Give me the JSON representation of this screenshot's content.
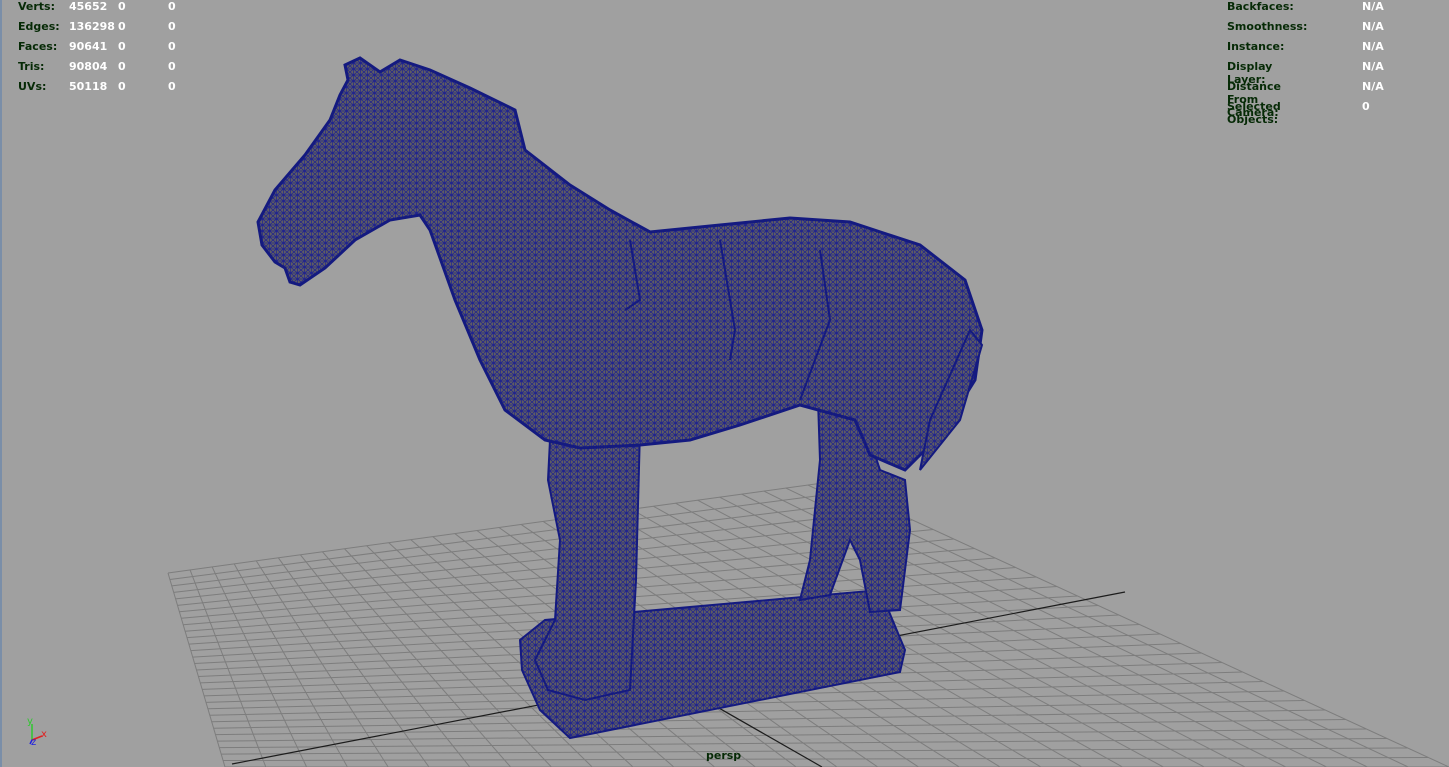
{
  "stats_left": {
    "rows": [
      {
        "label": "Verts:",
        "values": [
          "45652",
          "0",
          "0"
        ]
      },
      {
        "label": "Edges:",
        "values": [
          "136298",
          "0",
          "0"
        ]
      },
      {
        "label": "Faces:",
        "values": [
          "90641",
          "0",
          "0"
        ]
      },
      {
        "label": "Tris:",
        "values": [
          "90804",
          "0",
          "0"
        ]
      },
      {
        "label": "UVs:",
        "values": [
          "50118",
          "0",
          "0"
        ]
      }
    ]
  },
  "stats_right": {
    "rows": [
      {
        "label": "Backfaces:",
        "value": "N/A"
      },
      {
        "label": "Smoothness:",
        "value": "N/A"
      },
      {
        "label": "Instance:",
        "value": "N/A"
      },
      {
        "label": "Display Layer:",
        "value": "N/A"
      },
      {
        "label": "Distance From Camera:",
        "value": "N/A"
      },
      {
        "label": "Selected Objects:",
        "value": "0"
      }
    ]
  },
  "camera": {
    "name": "persp"
  },
  "axis": {
    "y": "y",
    "z": "z",
    "x": "x"
  },
  "colors": {
    "background": "#a0a0a0",
    "grid": "#7a7a7a",
    "wire": "#1a1f8a",
    "mesh_fill": "#6e6a63",
    "hud_label": "#062a06",
    "hud_value": "#ffffff"
  }
}
